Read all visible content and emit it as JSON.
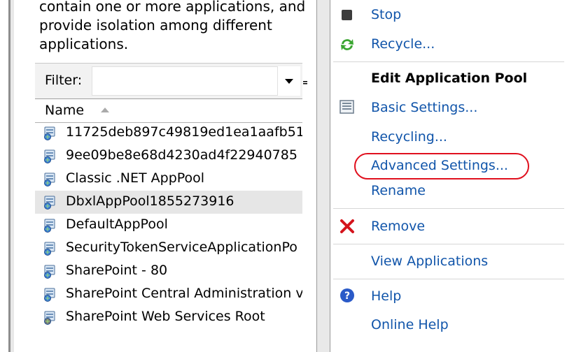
{
  "description": {
    "lines": [
      "contain one or more applications, and",
      "provide isolation among different",
      "applications."
    ]
  },
  "filter": {
    "label": "Filter:",
    "value": ""
  },
  "grid": {
    "column_header": "Name",
    "rows": [
      {
        "name": "11725deb897c49819ed1ea1aafb51",
        "selected": false,
        "icon": "app-pool-icon"
      },
      {
        "name": "9ee09be8e68d4230ad4f22940785",
        "selected": false,
        "icon": "app-pool-icon"
      },
      {
        "name": "Classic .NET AppPool",
        "selected": false,
        "icon": "app-pool-icon"
      },
      {
        "name": "DbxlAppPool1855273916",
        "selected": true,
        "icon": "app-pool-icon"
      },
      {
        "name": "DefaultAppPool",
        "selected": false,
        "icon": "app-pool-icon"
      },
      {
        "name": "SecurityTokenServiceApplicationPo",
        "selected": false,
        "icon": "app-pool-icon"
      },
      {
        "name": "SharePoint - 80",
        "selected": false,
        "icon": "app-pool-icon"
      },
      {
        "name": "SharePoint Central Administration v",
        "selected": false,
        "icon": "app-pool-icon"
      },
      {
        "name": "SharePoint Web Services Root",
        "selected": false,
        "icon": "app-pool-stopped-icon"
      }
    ]
  },
  "actions": {
    "stop": "Stop",
    "recycle": "Recycle...",
    "edit_section": "Edit Application Pool",
    "basic_settings": "Basic Settings...",
    "recycling": "Recycling...",
    "advanced_settings": "Advanced Settings...",
    "rename": "Rename",
    "remove": "Remove",
    "view_applications": "View Applications",
    "help": "Help",
    "online_help": "Online Help"
  },
  "colors": {
    "link": "#1155aa",
    "highlight_ring": "#e0101e",
    "selected_row": "#e6e6e6"
  }
}
